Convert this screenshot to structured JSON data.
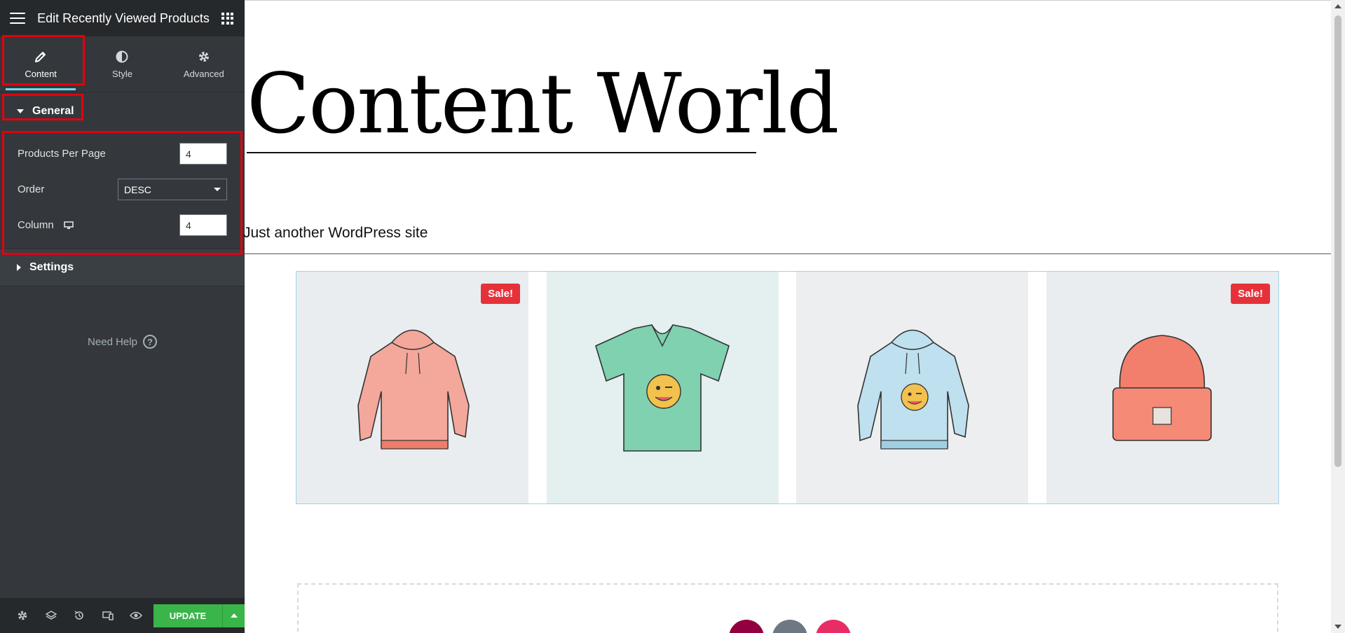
{
  "panel": {
    "title": "Edit Recently Viewed Products",
    "tabs": [
      {
        "label": "Content",
        "icon": "pencil-icon",
        "active": true
      },
      {
        "label": "Style",
        "icon": "contrast-icon",
        "active": false
      },
      {
        "label": "Advanced",
        "icon": "gear-icon",
        "active": false
      }
    ],
    "general": {
      "label": "General",
      "controls": {
        "products_per_page": {
          "label": "Products Per Page",
          "value": "4"
        },
        "order": {
          "label": "Order",
          "value": "DESC"
        },
        "column": {
          "label": "Column",
          "value": "4",
          "device_icon": "desktop-icon"
        }
      }
    },
    "settings": {
      "label": "Settings"
    },
    "need_help": "Need Help",
    "footer": {
      "icons": [
        "settings-icon",
        "layers-icon",
        "history-icon",
        "responsive-icon",
        "preview-eye-icon"
      ],
      "update_label": "UPDATE"
    }
  },
  "preview": {
    "site_title": "Content World",
    "tagline": "Just another WordPress site",
    "products": [
      {
        "name": "hoodie-pink",
        "sale": true,
        "sale_label": "Sale!",
        "bg": "#e9edf0"
      },
      {
        "name": "tshirt-green",
        "sale": false,
        "sale_label": "",
        "bg": "#e4efef"
      },
      {
        "name": "hoodie-blue",
        "sale": false,
        "sale_label": "",
        "bg": "#eceef0"
      },
      {
        "name": "beanie-orange",
        "sale": true,
        "sale_label": "Sale!",
        "bg": "#e9edf0"
      }
    ]
  },
  "colors": {
    "panel_bg": "#34383c",
    "panel_header": "#26292c",
    "accent_blue": "#71d7f7",
    "update_green": "#39b54a",
    "highlight_red": "#e3000f",
    "sale_red": "#e5323a"
  }
}
